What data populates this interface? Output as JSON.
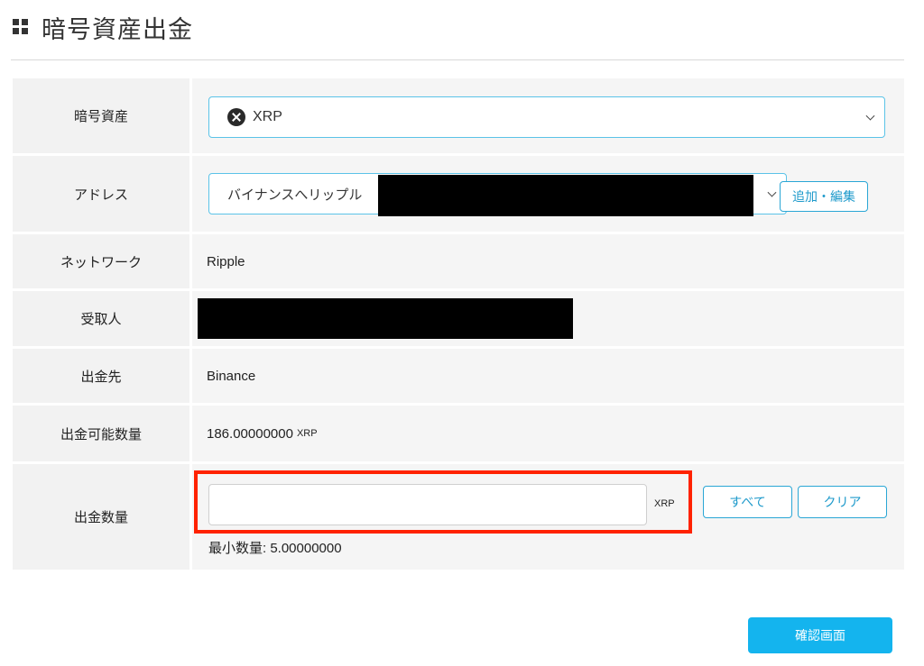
{
  "header": {
    "title": "暗号資産出金"
  },
  "rows": {
    "asset": {
      "label": "暗号資産",
      "value": "XRP"
    },
    "address": {
      "label": "アドレス",
      "value": "バイナンスへリップル",
      "add_edit_button": "追加・編集"
    },
    "network": {
      "label": "ネットワーク",
      "value": "Ripple"
    },
    "recipient": {
      "label": "受取人"
    },
    "destination": {
      "label": "出金先",
      "value": "Binance"
    },
    "available": {
      "label": "出金可能数量",
      "value": "186.00000000",
      "unit": "XRP"
    },
    "amount": {
      "label": "出金数量",
      "value": "",
      "placeholder": "",
      "unit": "XRP",
      "all_button": "すべて",
      "clear_button": "クリア",
      "minimum": "最小数量: 5.00000000"
    }
  },
  "confirm_button": "確認画面",
  "colors": {
    "accent": "#14b4ee",
    "border_accent": "#5bc3e8",
    "highlight": "#ff2200",
    "row_bg": "#f2f2f2"
  },
  "icons": {
    "title": "grid-icon",
    "asset": "xrp-icon",
    "dropdown": "chevron-down-icon"
  }
}
